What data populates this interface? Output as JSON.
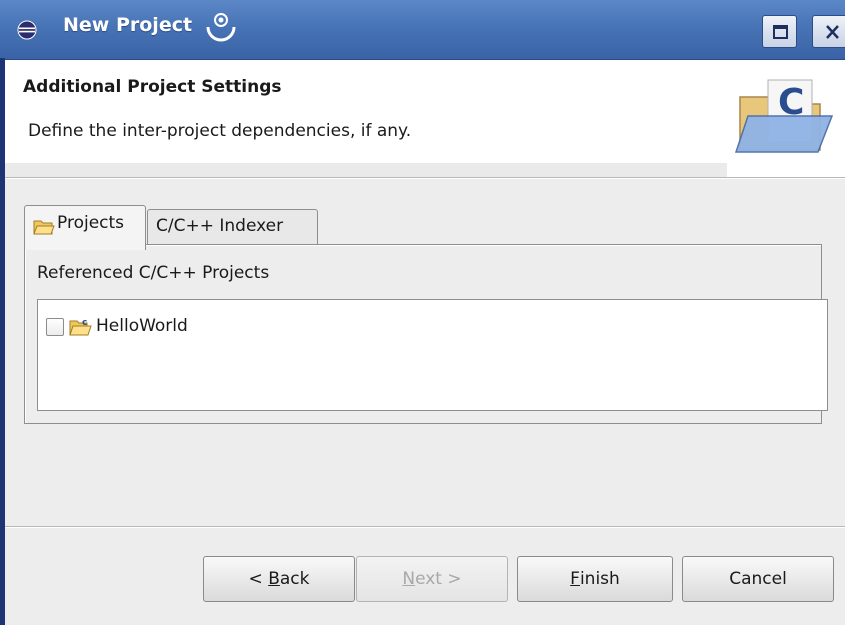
{
  "window": {
    "title": "New Project",
    "controls": {
      "maximize_icon": "maximize-icon",
      "close_icon": "close-icon"
    }
  },
  "header": {
    "title": "Additional Project Settings",
    "description": "Define the inter-project dependencies, if any.",
    "banner_icon": "c-project-folder-icon"
  },
  "tabs": [
    {
      "label": "Projects",
      "icon": "folder-icon",
      "selected": true
    },
    {
      "label": "C/C++ Indexer",
      "selected": false
    }
  ],
  "projects_tab": {
    "group_label": "Referenced C/C++ Projects",
    "items": [
      {
        "label": "HelloWorld",
        "checked": false,
        "icon": "c-project-icon"
      }
    ]
  },
  "buttons": {
    "back": {
      "pre": "< ",
      "mnemonic": "B",
      "rest": "ack",
      "enabled": true
    },
    "next": {
      "pre": "",
      "mnemonic": "N",
      "rest": "ext >",
      "enabled": false
    },
    "finish": {
      "pre": "",
      "mnemonic": "F",
      "rest": "inish",
      "enabled": true
    },
    "cancel": {
      "label": "Cancel",
      "enabled": true
    }
  },
  "colors": {
    "titlebar": "#4774b6",
    "dialog_bg": "#ededed",
    "header_bg": "#ffffff",
    "disabled_text": "#a8a8a8"
  }
}
